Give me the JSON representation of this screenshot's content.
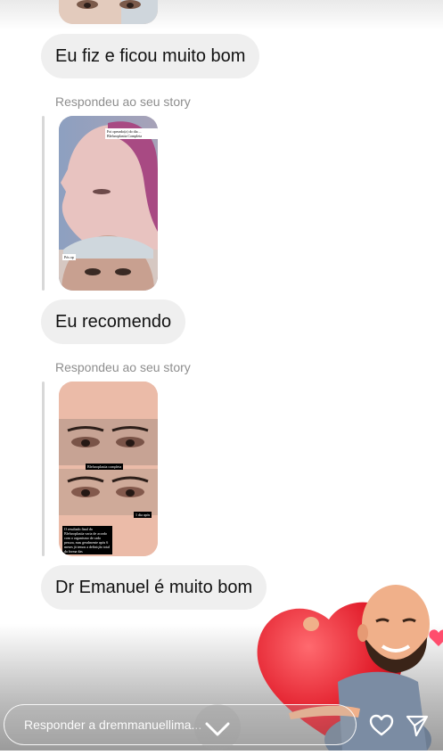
{
  "messages": [
    {
      "text": "Eu fiz e ficou muito bom"
    },
    {
      "caption": "Respondeu ao seu story"
    },
    {
      "text": "Eu recomendo"
    },
    {
      "caption": "Respondeu ao seu story"
    },
    {
      "text": "Dr Emanuel é muito bom"
    }
  ],
  "story1": {
    "label_top": "Foi operado(a) do dia ... Blefaroplastia Completa",
    "label_bottom": "Pós op"
  },
  "story2": {
    "label_mid": "Blefaroplastia completa",
    "label_right": "1 dia após",
    "label_bottom": "O resultado final da Blefaroplastia varia de acordo com o organismo de cada pessoa, mas geralmente após 6 meses já temos a definição total da forma das"
  },
  "reply_bar": {
    "placeholder": "Responder a dremmanuellima..."
  },
  "icons": {
    "chevron": "chevron-down-icon",
    "heart": "heart-icon",
    "send": "send-icon"
  },
  "colors": {
    "bubble_bg": "#efefef",
    "caption": "#8e8e8e",
    "heart_red": "#e11c2a"
  }
}
